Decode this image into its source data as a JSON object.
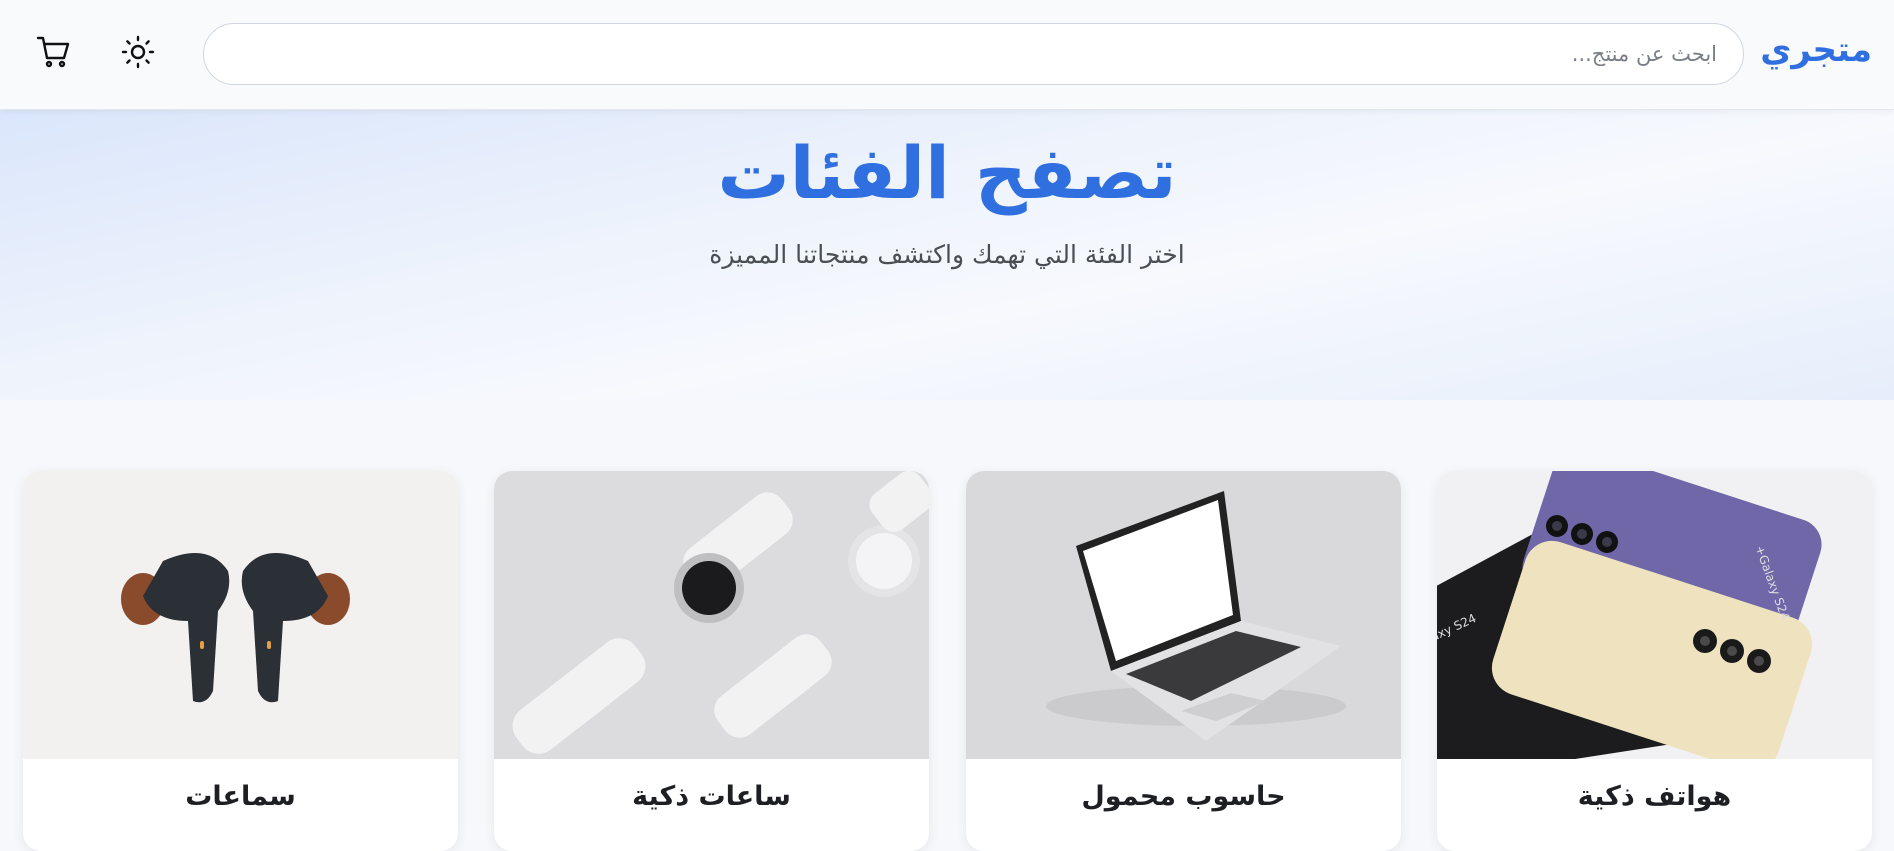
{
  "header": {
    "logo": "متجري",
    "search_placeholder": "ابحث عن منتج...",
    "theme_icon": "sun-icon",
    "cart_icon": "cart-icon"
  },
  "hero": {
    "title": "تصفح الفئات",
    "subtitle": "اختر الفئة التي تهمك واكتشف منتجاتنا المميزة"
  },
  "categories": [
    {
      "label": "هواتف ذكية",
      "icon": "smartphones-image"
    },
    {
      "label": "حاسوب محمول",
      "icon": "laptop-image"
    },
    {
      "label": "ساعات ذكية",
      "icon": "smartwatch-image"
    },
    {
      "label": "سماعات",
      "icon": "earbuds-image"
    }
  ],
  "colors": {
    "brand": "#2f6fdf",
    "background": "#f6f8fb"
  }
}
